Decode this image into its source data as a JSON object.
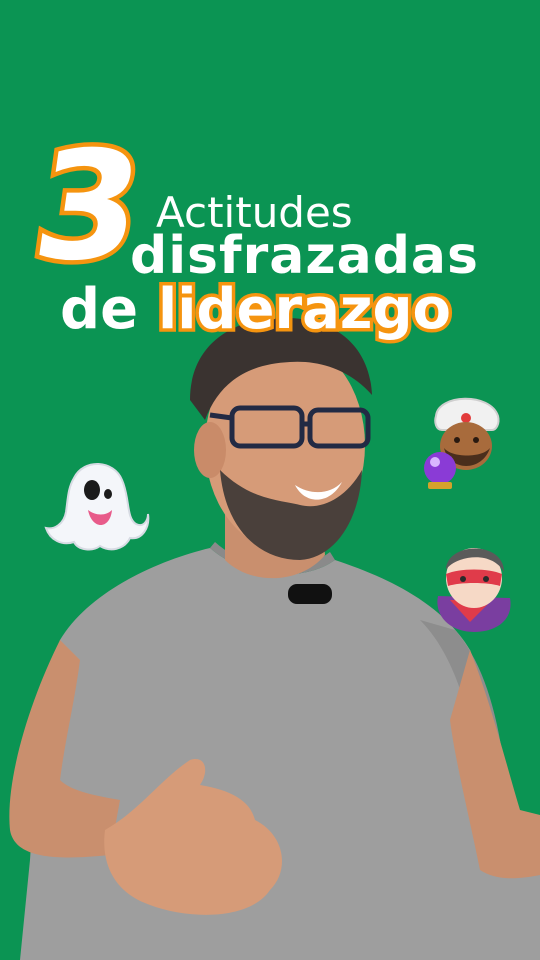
{
  "headline": {
    "number": "3",
    "line1": "Actitudes",
    "line2": "disfrazadas",
    "line3_prefix": "de",
    "line3_highlight": "liderazgo"
  },
  "colors": {
    "background": "#0b9453",
    "accent": "#f5940f",
    "text": "#ffffff",
    "shirt": "#9e9e9e"
  },
  "emojis": [
    "ghost-emoji",
    "fortune-teller-with-crystal-ball-emoji",
    "masked-superhero-emoji"
  ]
}
